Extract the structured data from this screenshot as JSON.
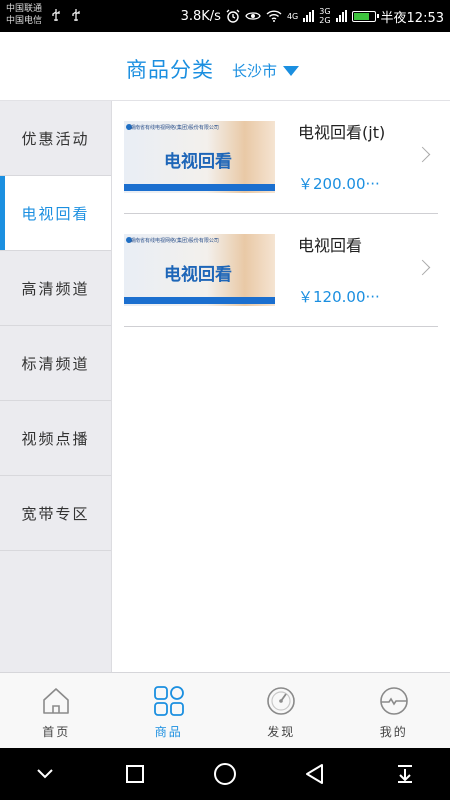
{
  "status_bar": {
    "carrier_1": "中国联通",
    "carrier_2": "中国电信",
    "speed": "3.8K/s",
    "network_a": "4G",
    "network_b": "3G",
    "network_c": "2G",
    "time": "半夜12:53"
  },
  "header": {
    "title": "商品分类",
    "city": "长沙市"
  },
  "sidebar": {
    "items": [
      {
        "label": "优惠活动"
      },
      {
        "label": "电视回看"
      },
      {
        "label": "高清频道"
      },
      {
        "label": "标清频道"
      },
      {
        "label": "视频点播"
      },
      {
        "label": "宽带专区"
      }
    ],
    "active_index": 1
  },
  "products": [
    {
      "name": "电视回看(jt)",
      "price": "￥200.00···",
      "thumb_title": "电视回看",
      "thumb_header": "湖南省有线电视网络(集团)股份有限公司"
    },
    {
      "name": "电视回看",
      "price": "￥120.00···",
      "thumb_title": "电视回看",
      "thumb_header": "湖南省有线电视网络(集团)股份有限公司"
    }
  ],
  "tabbar": {
    "items": [
      {
        "label": "首页",
        "icon": "house-icon"
      },
      {
        "label": "商品",
        "icon": "grid-icon"
      },
      {
        "label": "发现",
        "icon": "compass-icon"
      },
      {
        "label": "我的",
        "icon": "profile-icon"
      }
    ],
    "active_index": 1
  },
  "navbar": {
    "buttons": [
      "chevron-down-icon",
      "recents-square-icon",
      "home-circle-icon",
      "back-triangle-icon",
      "notification-pull-icon"
    ]
  },
  "colors": {
    "accent": "#1b8fe0",
    "sidebar_bg": "#ebebef",
    "battery": "#3ec43e"
  }
}
